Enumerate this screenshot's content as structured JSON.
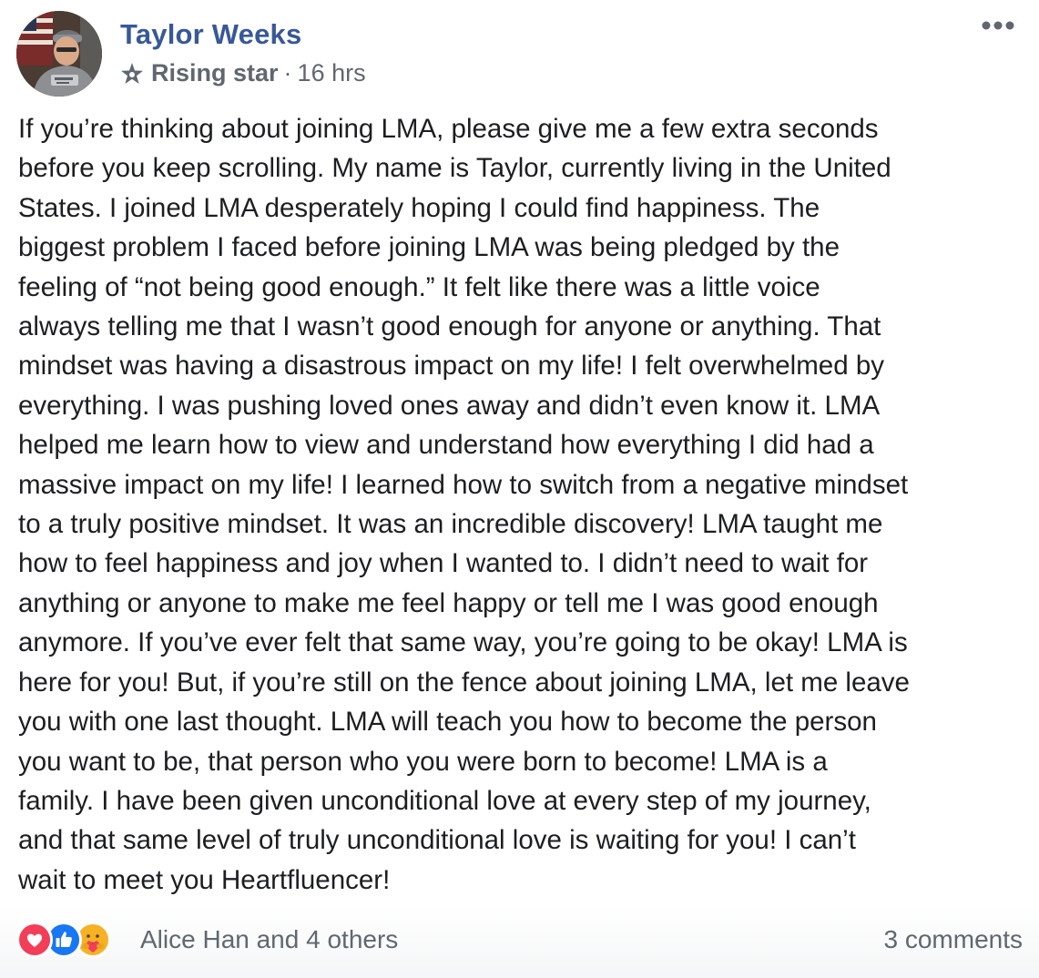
{
  "post": {
    "author": "Taylor Weeks",
    "badge": "Rising star",
    "separator": "·",
    "time": "16 hrs",
    "body": "If you’re thinking about joining LMA, please give me a few extra seconds\nbefore you keep scrolling. My name is Taylor, currently living in the United\nStates. I joined LMA desperately hoping I could find happiness. The\nbiggest problem I faced before joining LMA was being pledged by the\nfeeling of “not being good enough.” It felt like there was a little voice\nalways telling me that I wasn’t good enough for anyone or anything. That\nmindset was having a disastrous impact on my life! I felt overwhelmed by\neverything. I was pushing loved ones away and didn’t even know it. LMA\nhelped me learn how to view and understand how everything I did had a\nmassive impact on my life! I learned how to switch from a negative mindset\nto a truly positive mindset. It was an incredible discovery! LMA taught me\nhow to feel happiness and joy when I wanted to. I didn’t need to wait for\nanything or anyone to make me feel happy or tell me I was good enough\nanymore. If you’ve ever felt that same way, you’re going to be okay! LMA is\nhere for you! But, if you’re still on the fence about joining LMA, let me leave\nyou with one last thought. LMA will teach you how to become the person\nyou want to be, that person who you were born to become! LMA is a\nfamily. I have been given unconditional love at every step of my journey,\nand that same level of truly unconditional love is waiting for you! I can’t\nwait to meet you Heartfluencer!"
  },
  "footer": {
    "reactors": "Alice Han and 4 others",
    "comments": "3 comments",
    "reactions": [
      "love-reaction-icon",
      "like-reaction-icon",
      "care-reaction-icon"
    ]
  },
  "colors": {
    "author_link": "#385898",
    "meta_text": "#606770",
    "body_text": "#1c1e21",
    "love": "#f33e58",
    "like": "#1877f2",
    "care": "#f7b125"
  },
  "icons": {
    "badge": "star-icon",
    "more": "more-options-icon"
  }
}
